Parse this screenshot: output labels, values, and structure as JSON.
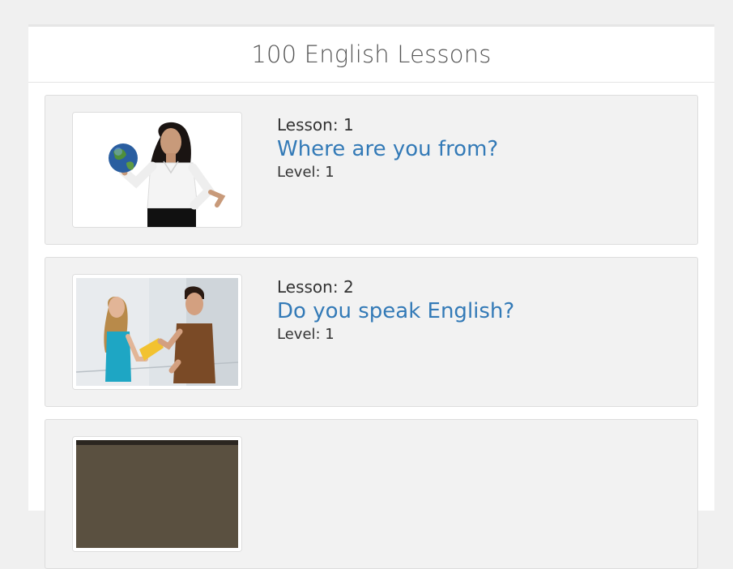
{
  "header": {
    "title": "100 English Lessons"
  },
  "lessons": [
    {
      "lesson_label": "Lesson: 1",
      "title": "Where are you from?",
      "level_label": "Level: 1",
      "thumbnail": "woman-holding-globe-photo"
    },
    {
      "lesson_label": "Lesson: 2",
      "title": "Do you speak English?",
      "level_label": "Level: 1",
      "thumbnail": "two-people-talking-photo"
    },
    {
      "thumbnail": "lesson-3-photo"
    }
  ],
  "colors": {
    "link": "#337ab7",
    "card_bg": "#f2f2f2",
    "page_bg": "#f0f0f0"
  }
}
